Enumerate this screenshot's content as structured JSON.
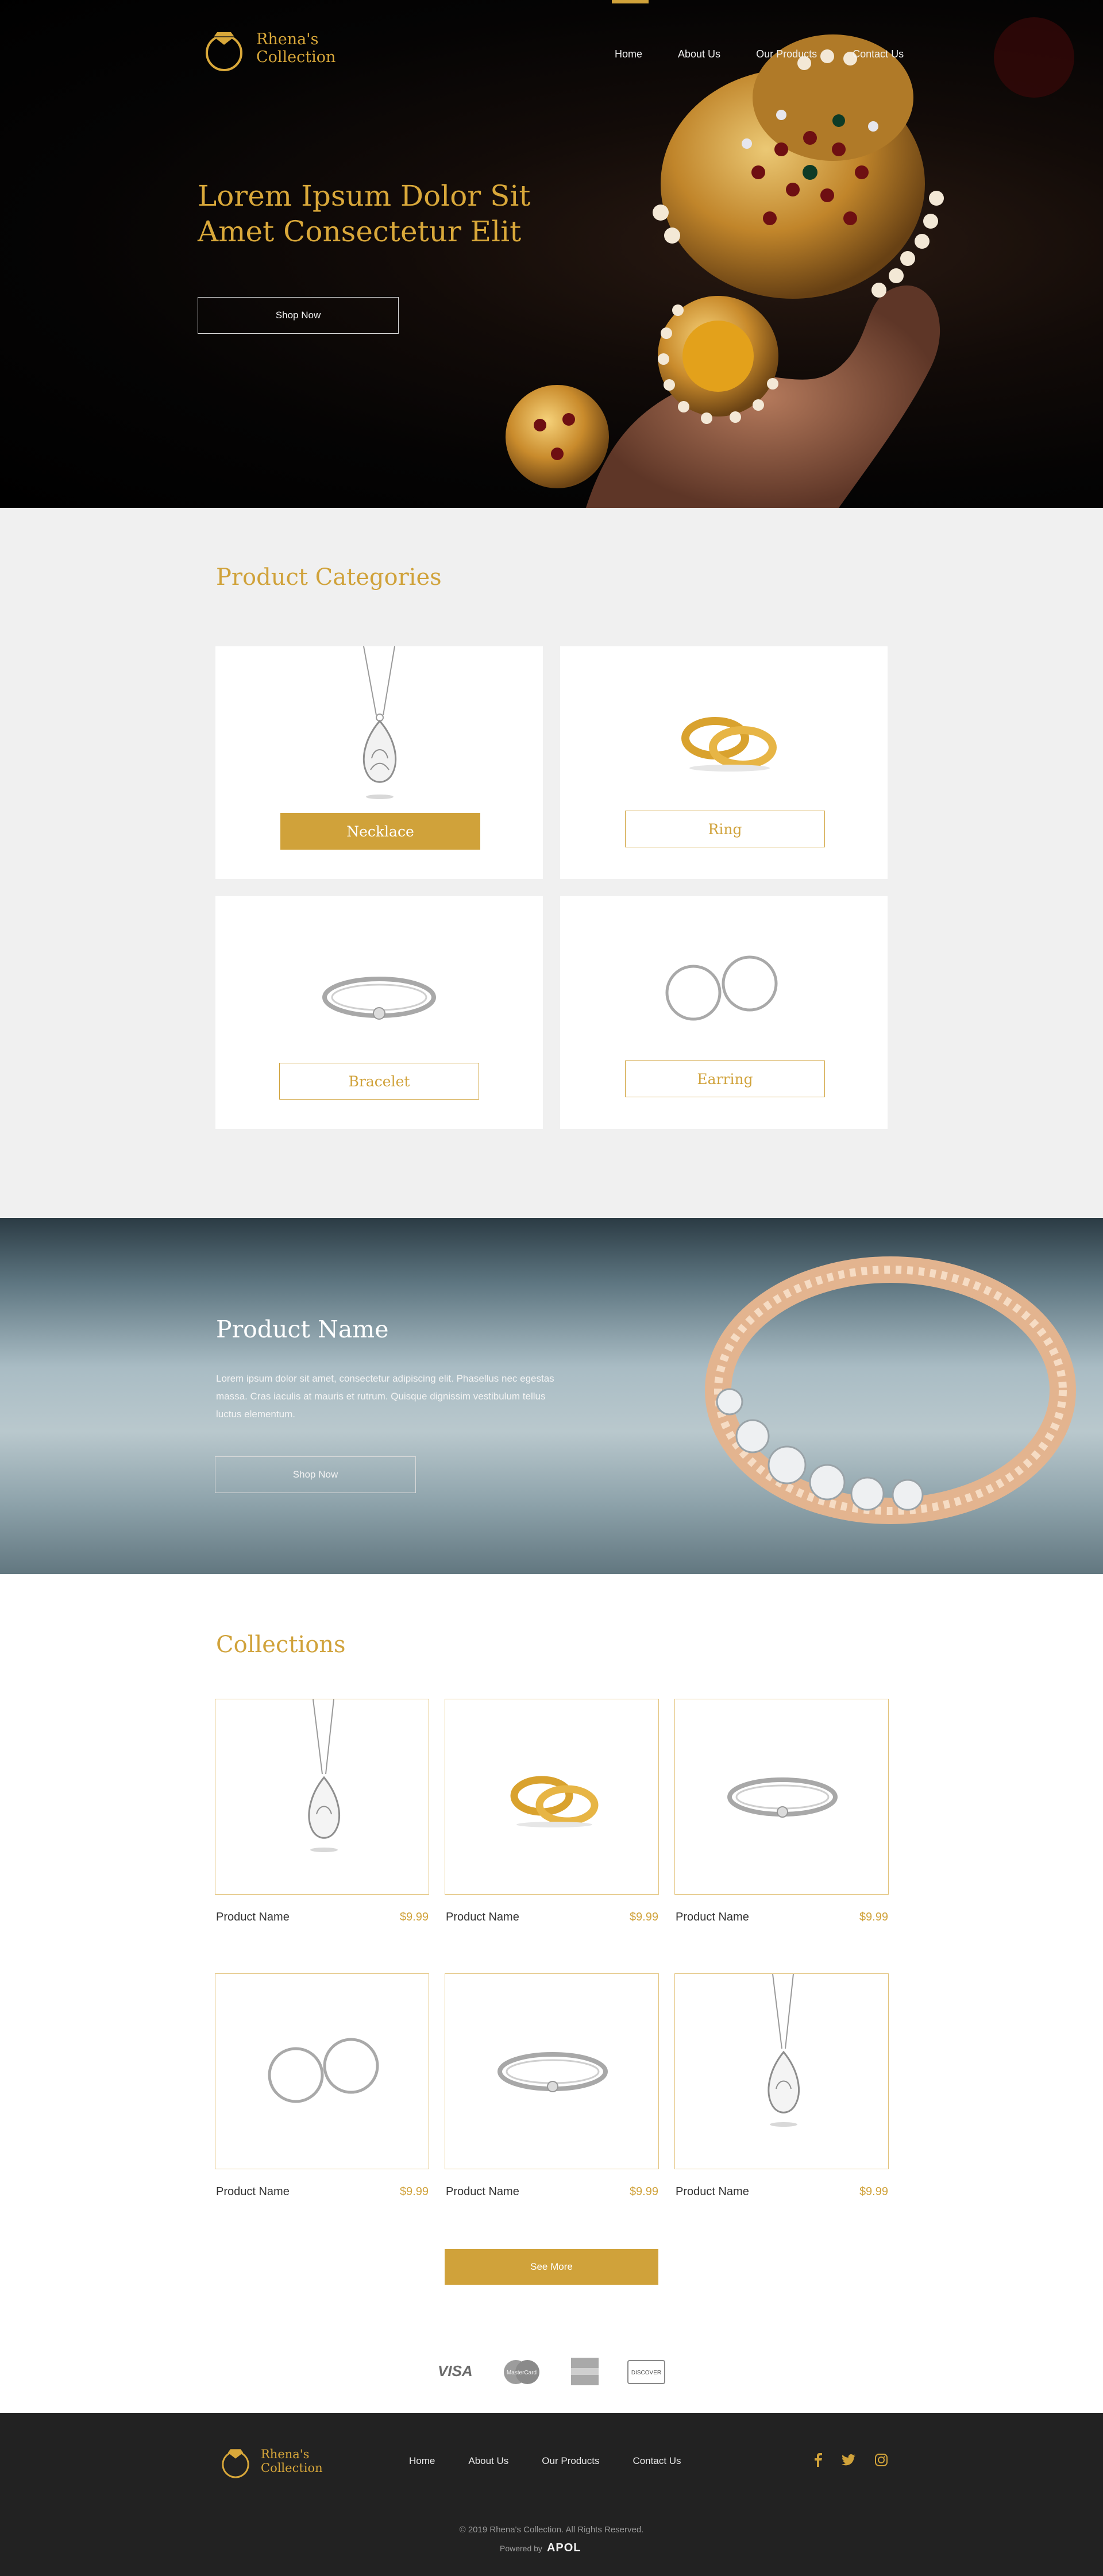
{
  "brand": {
    "name_line1": "Rhena's",
    "name_line2": "Collection"
  },
  "nav": {
    "home": "Home",
    "about": "About Us",
    "products": "Our Products",
    "contact": "Contact Us"
  },
  "hero": {
    "title": "Lorem Ipsum Dolor Sit Amet Consectetur Elit",
    "button": "Shop Now"
  },
  "categories": {
    "title": "Product Categories",
    "items": [
      {
        "label": "Necklace",
        "icon": "necklace-icon",
        "active": true
      },
      {
        "label": "Ring",
        "icon": "ring-icon",
        "active": false
      },
      {
        "label": "Bracelet",
        "icon": "bracelet-icon",
        "active": false
      },
      {
        "label": "Earring",
        "icon": "earring-icon",
        "active": false
      }
    ]
  },
  "feature": {
    "title": "Product Name",
    "text": "Lorem ipsum dolor sit amet, consectetur adipiscing elit. Phasellus nec egestas massa. Cras iaculis at mauris et rutrum. Quisque dignissim vestibulum tellus luctus elementum.",
    "button": "Shop Now"
  },
  "collections": {
    "title": "Collections",
    "products": [
      {
        "name": "Product Name",
        "price": "$9.99",
        "icon": "necklace-icon"
      },
      {
        "name": "Product Name",
        "price": "$9.99",
        "icon": "ring-icon"
      },
      {
        "name": "Product Name",
        "price": "$9.99",
        "icon": "bracelet-icon"
      },
      {
        "name": "Product Name",
        "price": "$9.99",
        "icon": "earring-icon"
      },
      {
        "name": "Product Name",
        "price": "$9.99",
        "icon": "bracelet-icon"
      },
      {
        "name": "Product Name",
        "price": "$9.99",
        "icon": "necklace-icon"
      }
    ],
    "see_more": "See More"
  },
  "payments": [
    {
      "icon": "visa-icon",
      "label": "VISA"
    },
    {
      "icon": "mastercard-icon",
      "label": "MasterCard"
    },
    {
      "icon": "amex-icon",
      "label": ""
    },
    {
      "icon": "discover-icon",
      "label": "DISCOVER"
    }
  ],
  "footer": {
    "copyright": "© 2019 Rhena's Collection. All Rights Reserved.",
    "powered_by": "Powered by",
    "powered_brand": "APOL",
    "social": [
      "facebook-icon",
      "twitter-icon",
      "instagram-icon"
    ]
  },
  "colors": {
    "gold": "#d0a23a",
    "dark": "#222222",
    "light_bg": "#f0f0f0"
  }
}
